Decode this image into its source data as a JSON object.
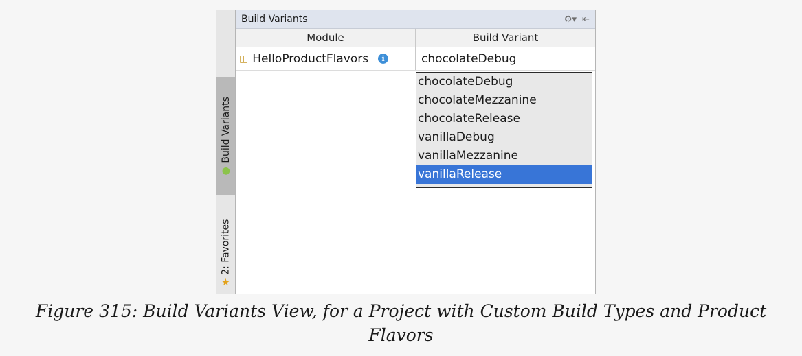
{
  "panel": {
    "title": "Build Variants",
    "toolbar_icons": [
      "gear-icon",
      "hide-icon"
    ]
  },
  "table": {
    "headers": [
      "Module",
      "Build Variant"
    ],
    "rows": [
      {
        "module": "HelloProductFlavors",
        "variant": "chocolateDebug"
      }
    ]
  },
  "dropdown": {
    "options": [
      "chocolateDebug",
      "chocolateMezzanine",
      "chocolateRelease",
      "vanillaDebug",
      "vanillaMezzanine",
      "vanillaRelease"
    ],
    "highlighted": "vanillaRelease"
  },
  "side_tabs": {
    "build_variants": "Build Variants",
    "favorites": "2: Favorites"
  },
  "caption": {
    "line1": "Figure 315: Build Variants View, for a Project with Custom Build Types and Product",
    "line2": "Flavors"
  },
  "colors": {
    "selection": "#3875d7",
    "titlebar": "#dfe4ee"
  }
}
